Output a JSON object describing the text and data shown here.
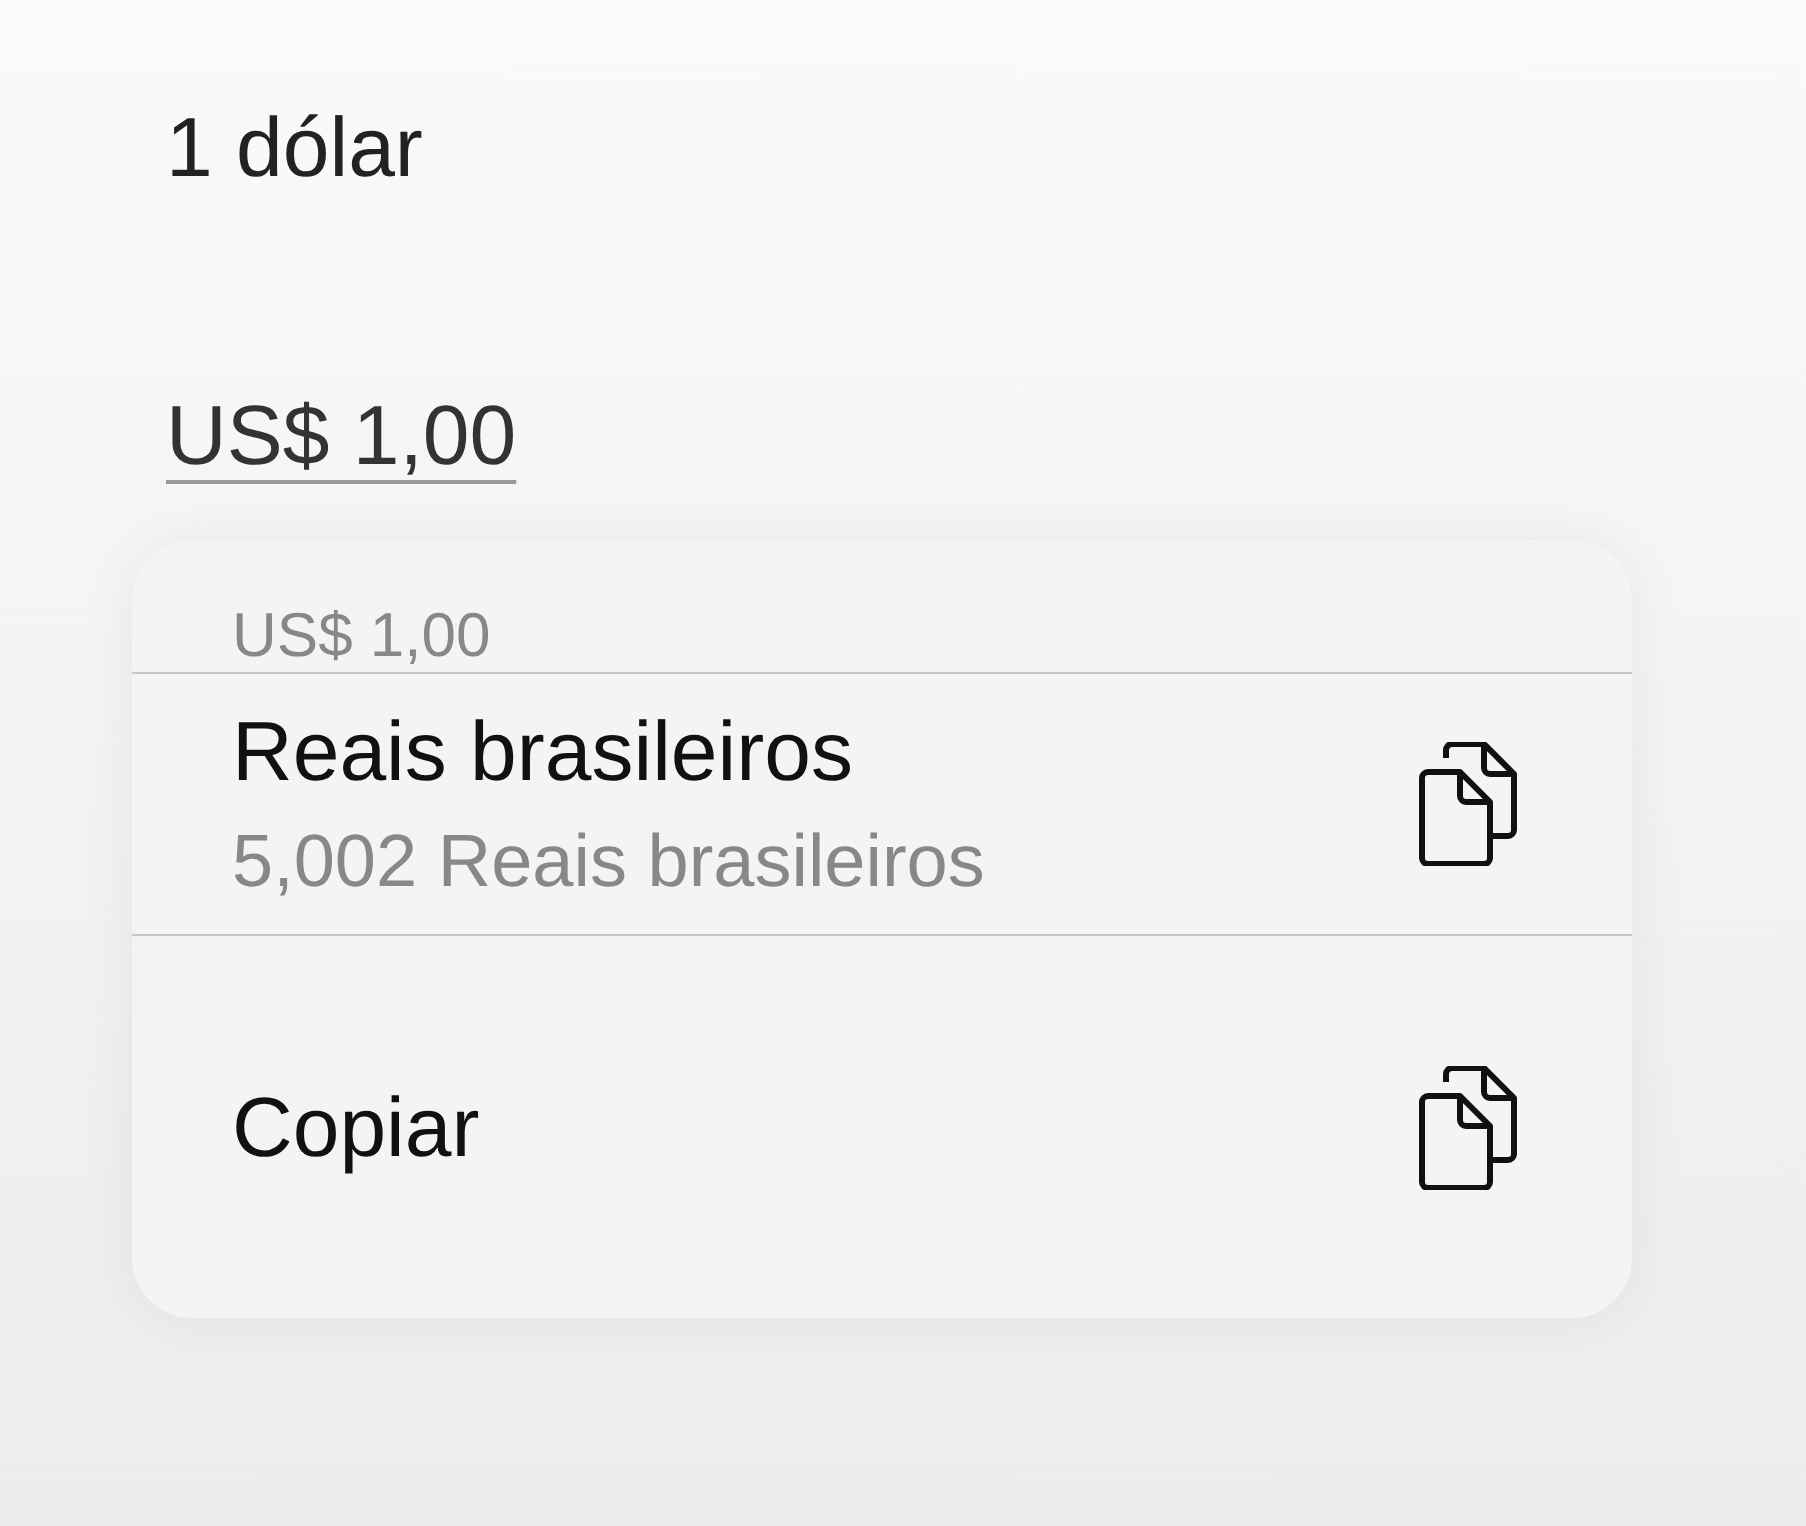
{
  "heading": "1 dólar",
  "amount": "US$ 1,00",
  "menu": {
    "header": "US$ 1,00",
    "items": [
      {
        "kind": "conversion",
        "title": "Reais brasileiros",
        "subtitle": "5,002 Reais brasileiros"
      },
      {
        "kind": "action",
        "title": "Copiar"
      }
    ]
  }
}
